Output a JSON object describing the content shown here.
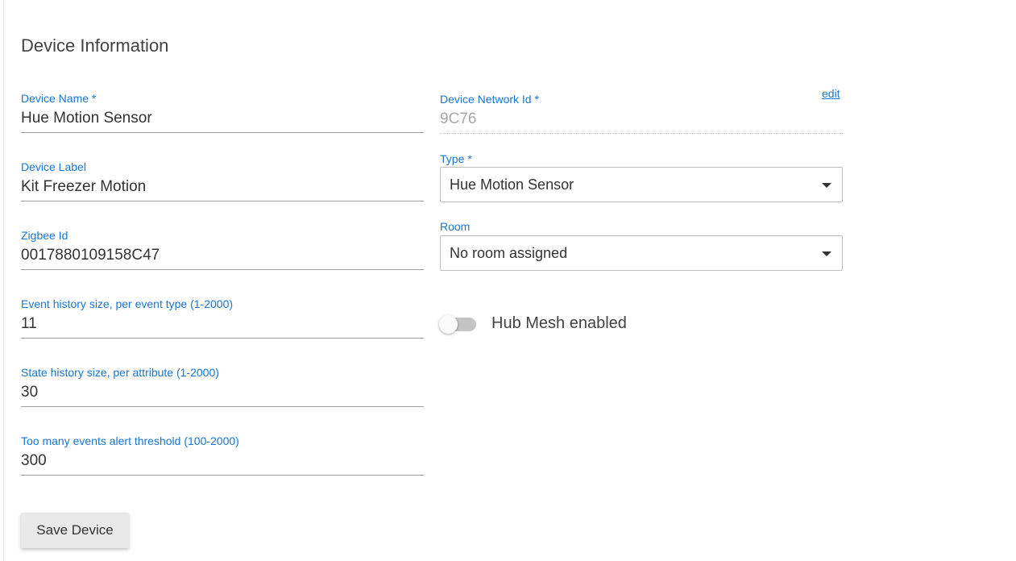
{
  "section": {
    "title": "Device Information"
  },
  "left_fields": [
    {
      "label": "Device Name *",
      "value": "Hue Motion Sensor"
    },
    {
      "label": "Device Label",
      "value": "Kit Freezer Motion"
    },
    {
      "label": "Zigbee Id",
      "value": "0017880109158C47"
    },
    {
      "label": "Event history size, per event type (1-2000)",
      "value": "11"
    },
    {
      "label": "State history size, per attribute (1-2000)",
      "value": "30"
    },
    {
      "label": "Too many events alert threshold (100-2000)",
      "value": "300"
    }
  ],
  "network_id": {
    "label": "Device Network Id *",
    "value": "9C76",
    "edit_link": "edit"
  },
  "type_select": {
    "label": "Type *",
    "selected": "Hue Motion Sensor"
  },
  "room_select": {
    "label": "Room",
    "selected": "No room assigned"
  },
  "hub_mesh": {
    "label": "Hub Mesh enabled",
    "enabled": false
  },
  "actions": {
    "save_label": "Save Device"
  },
  "colors": {
    "accent": "#1976d2",
    "text": "#333333",
    "toggle_off": "#c4c4c4"
  }
}
